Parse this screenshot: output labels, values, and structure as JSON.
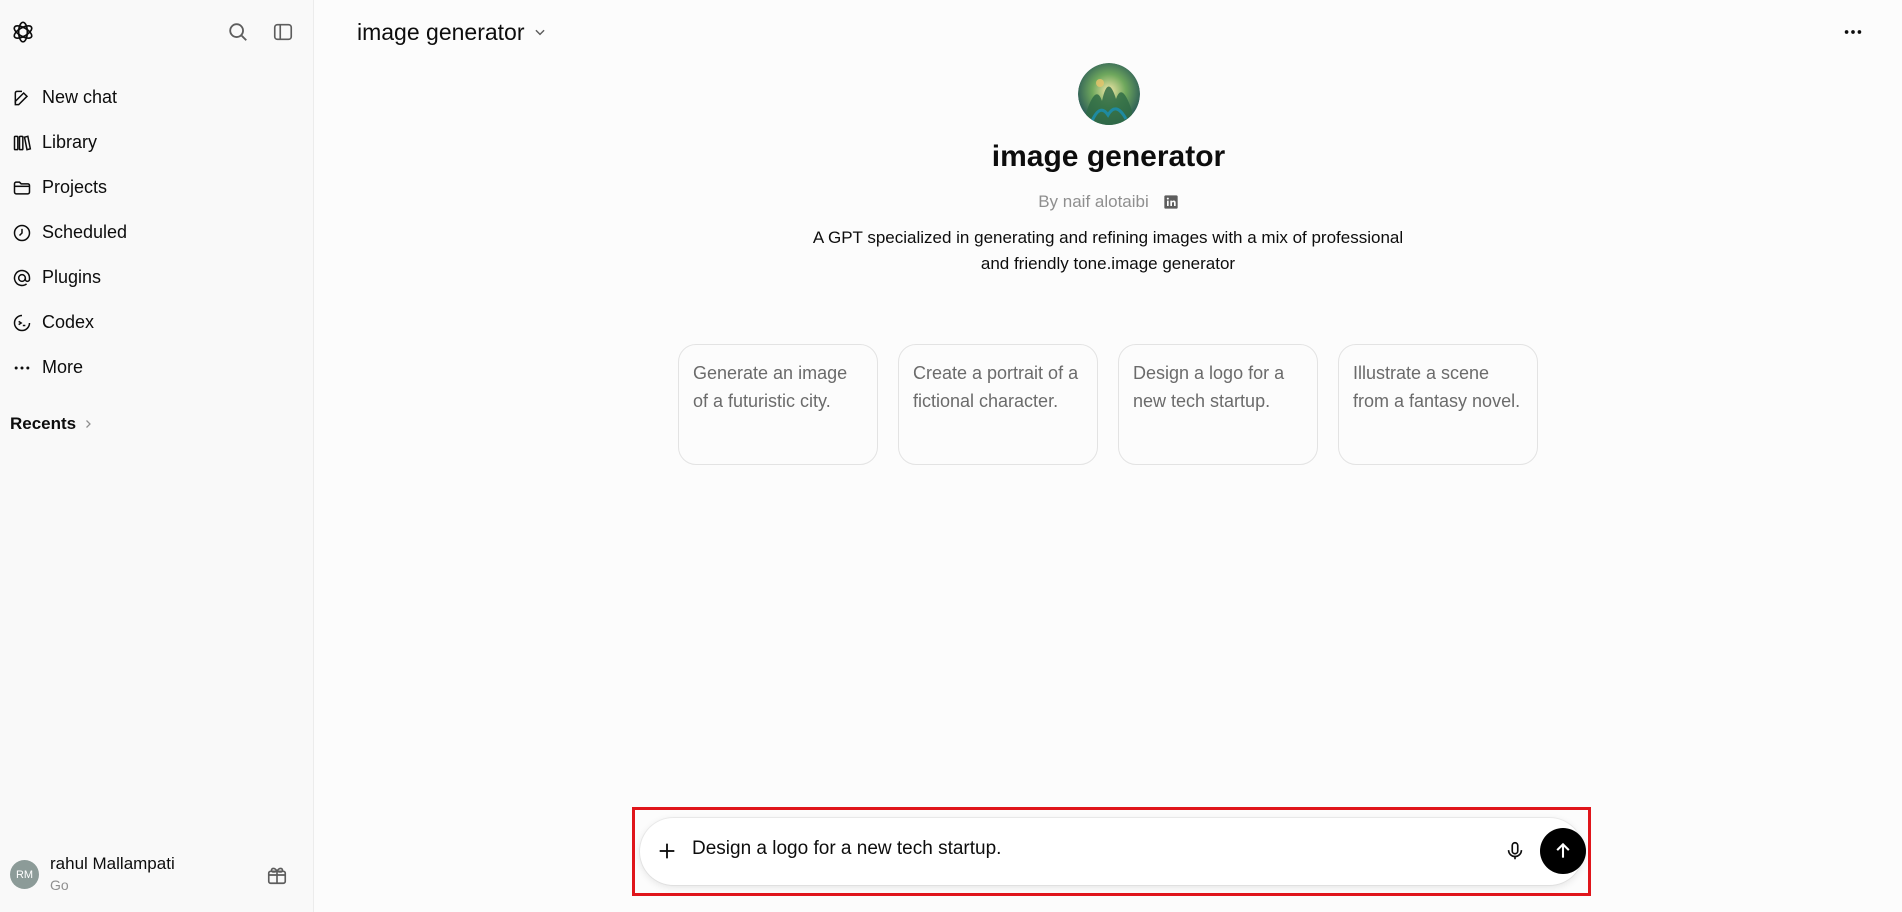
{
  "sidebar": {
    "logo_icon": "openai-logo-icon",
    "search_icon": "search-icon",
    "toggle_icon": "sidebar-toggle-icon",
    "items": [
      {
        "label": "New chat",
        "icon": "edit-icon"
      },
      {
        "label": "Library",
        "icon": "library-icon"
      },
      {
        "label": "Projects",
        "icon": "folder-icon"
      },
      {
        "label": "Scheduled",
        "icon": "clock-icon"
      },
      {
        "label": "Plugins",
        "icon": "at-icon"
      },
      {
        "label": "Codex",
        "icon": "codex-icon"
      },
      {
        "label": "More",
        "icon": "dots-icon"
      }
    ],
    "recents_label": "Recents",
    "user": {
      "initials": "RM",
      "name": "rahul Mallampati",
      "plan": "Go"
    }
  },
  "header": {
    "model_label": "image generator"
  },
  "gpt": {
    "title": "image generator",
    "by": "By naif alotaibi",
    "description": "A GPT specialized in generating and refining images with a mix of professional and friendly tone.image generator"
  },
  "starters": [
    "Generate an image of a futuristic city.",
    "Create a portrait of a fictional character.",
    "Design a logo for a new tech startup.",
    "Illustrate a scene from a fantasy novel."
  ],
  "composer": {
    "value": "Design a logo for a new tech startup."
  },
  "colors": {
    "highlight_border": "#e0151b",
    "send_button": "#000000",
    "avatar_bg": "#8c9b98"
  }
}
